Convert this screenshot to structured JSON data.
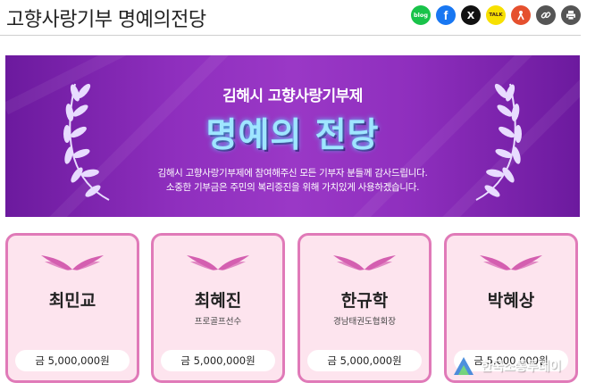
{
  "page": {
    "title": "고향사랑기부 명예의전당"
  },
  "share": {
    "buttons": [
      {
        "name": "blog",
        "label": "blog",
        "color": "#19c34a"
      },
      {
        "name": "facebook",
        "label": "f",
        "color": "#1877f2"
      },
      {
        "name": "x",
        "label": "X",
        "color": "#111111"
      },
      {
        "name": "kakaotalk",
        "label": "TALK",
        "color": "#f7e000"
      },
      {
        "name": "kakaostory",
        "label": "",
        "color": "#e5502e"
      },
      {
        "name": "link",
        "label": "",
        "color": "#555555"
      },
      {
        "name": "print",
        "label": "",
        "color": "#555555"
      }
    ]
  },
  "banner": {
    "subtitle": "김해시 고향사랑기부제",
    "title": "명예의 전당",
    "desc_line1": "김해시 고향사랑기부제에 참여해주신 모든 기부자 분들께 감사드립니다.",
    "desc_line2": "소중한 기부금은 주민의 복리증진을 위해 가치있게 사용하겠습니다.",
    "colors": {
      "background": "#8f2fbe",
      "title": "#9fe6ff"
    }
  },
  "donors": [
    {
      "name": "최민교",
      "role": "",
      "amount": "금 5,000,000원"
    },
    {
      "name": "최혜진",
      "role": "프로골프선수",
      "amount": "금 5,000,000원"
    },
    {
      "name": "한규학",
      "role": "경남태권도협회장",
      "amount": "금 5,000,000원"
    },
    {
      "name": "박혜상",
      "role": "",
      "amount": "금 5,000,000원"
    }
  ],
  "card_colors": {
    "border": "#e07ab8",
    "background": "#fde4ee",
    "wings": "#d45fb0"
  },
  "watermark": {
    "text": "한국소통투데이"
  }
}
